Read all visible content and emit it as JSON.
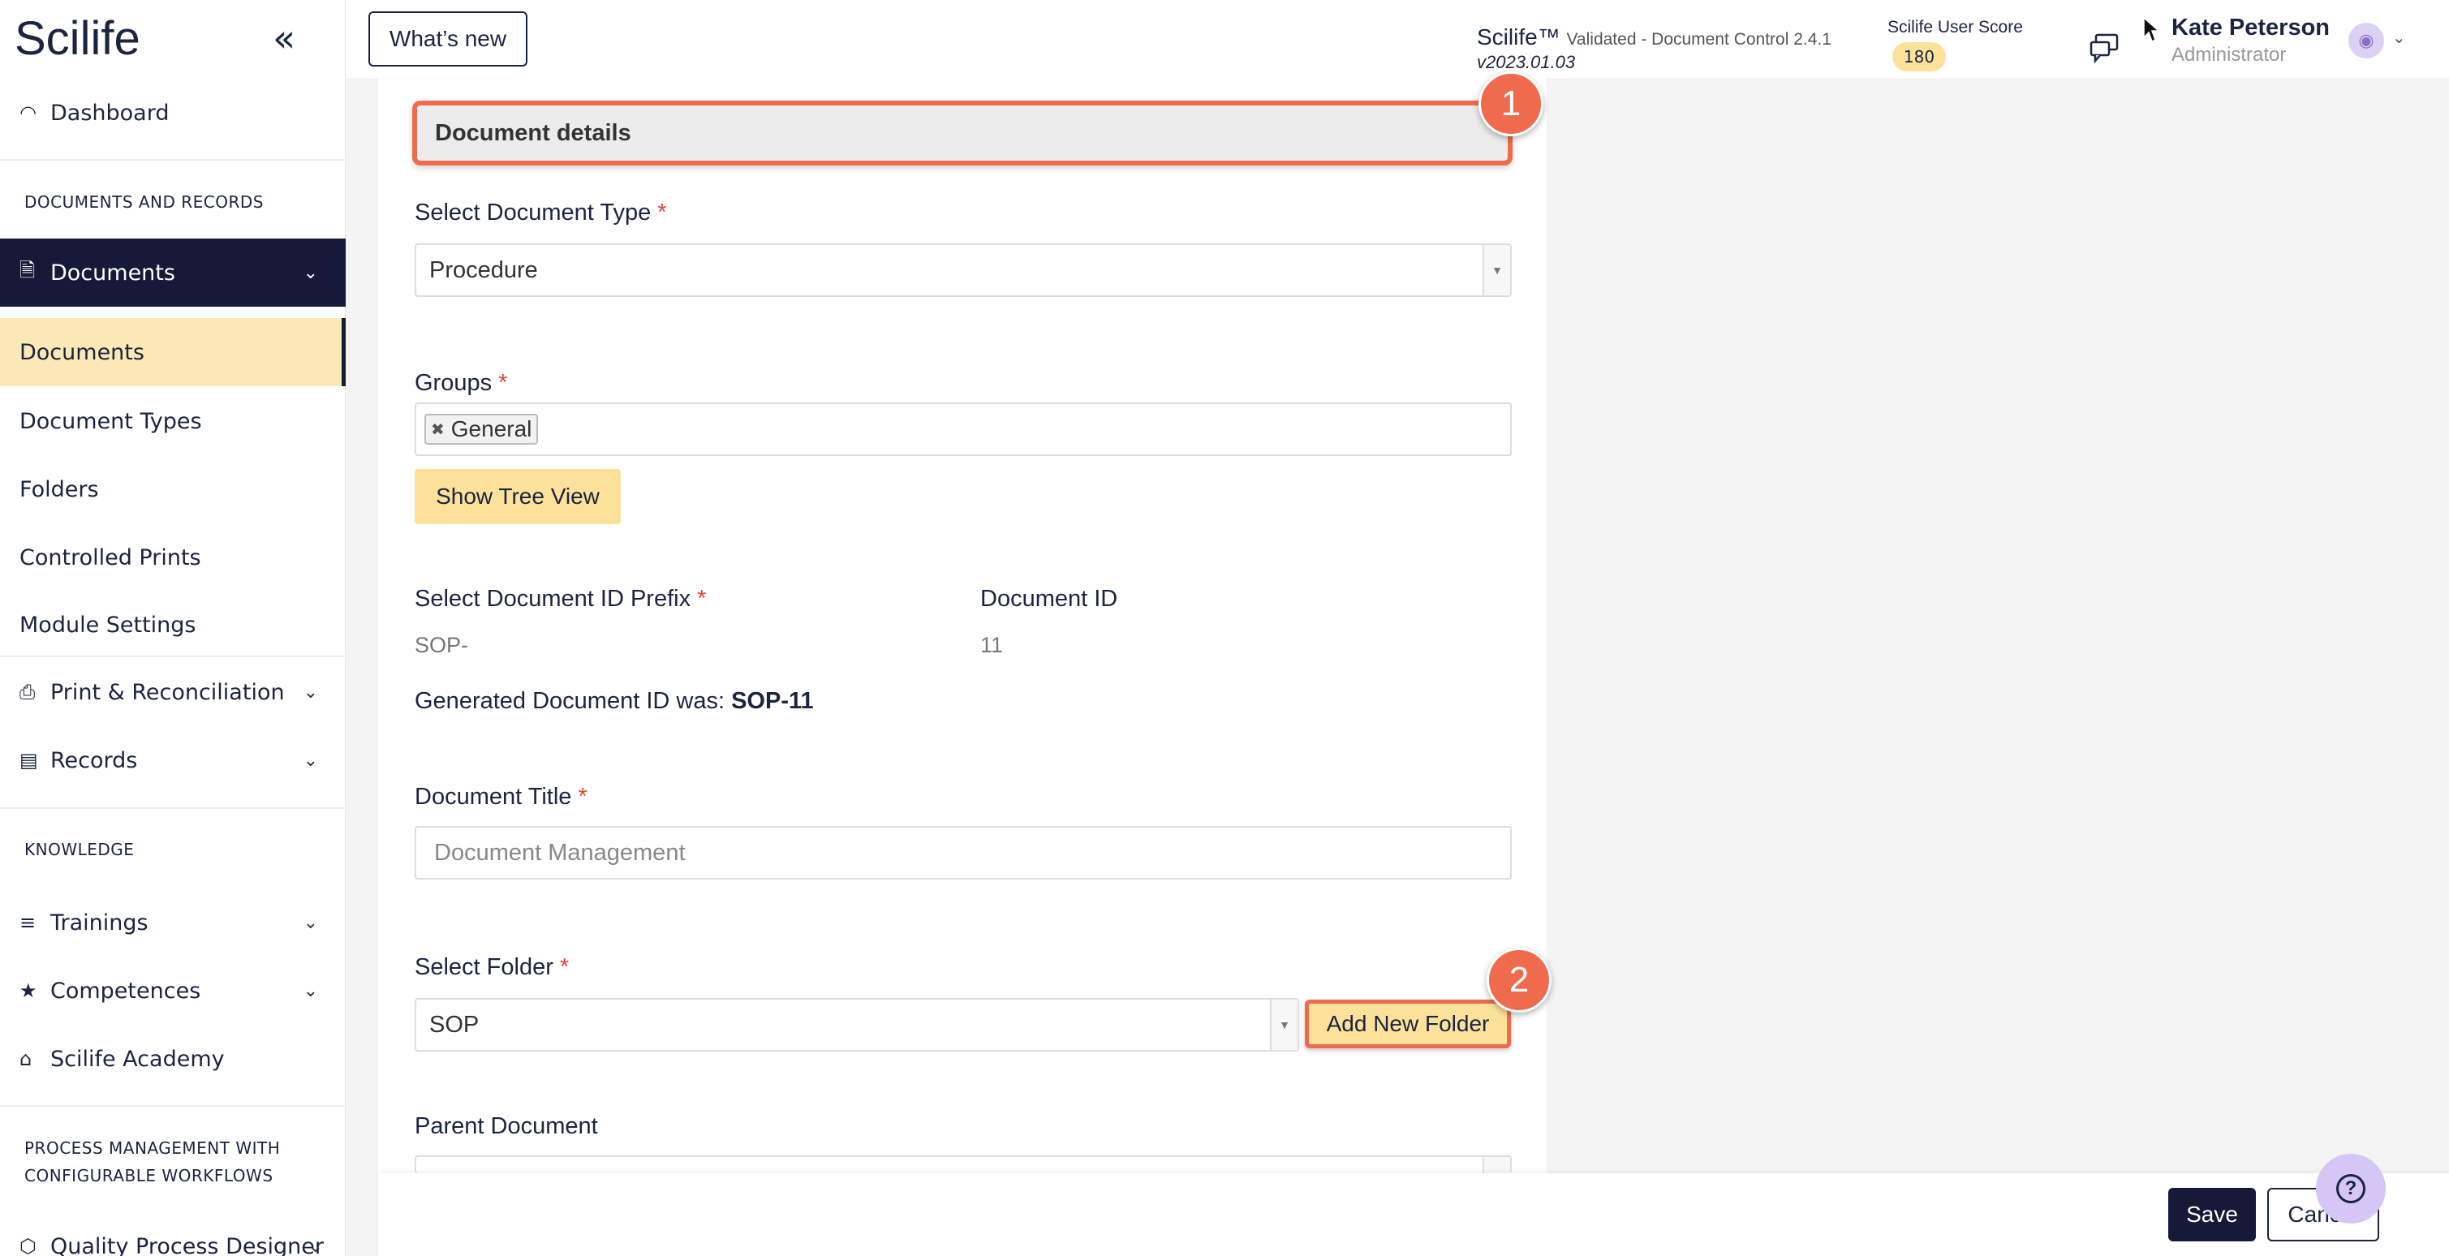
{
  "brand": {
    "logo": "Scilife",
    "collapse_icon": "double-chevron-left-icon"
  },
  "sidebar": {
    "dashboard": "Dashboard",
    "section_docs": "DOCUMENTS AND RECORDS",
    "documents_parent": "Documents",
    "sub_items": [
      "Documents",
      "Document Types",
      "Folders",
      "Controlled Prints",
      "Module Settings"
    ],
    "print_reconciliation": "Print & Reconciliation",
    "records": "Records",
    "section_knowledge": "KNOWLEDGE",
    "trainings": "Trainings",
    "competences": "Competences",
    "academy": "Scilife Academy",
    "section_process_1": "PROCESS MANAGEMENT WITH",
    "section_process_2": "CONFIGURABLE WORKFLOWS",
    "quality_process": "Quality Process Designer"
  },
  "topbar": {
    "whats_new": "What’s new",
    "app_name": "Scilife™",
    "app_validated": "Validated - Document Control 2.4.1",
    "app_version": "v2023.01.03",
    "score_label": "Scilife User Score",
    "score_value": "180",
    "user_name": "Kate Peterson",
    "user_role": "Administrator"
  },
  "form": {
    "section_title": "Document details",
    "step1": "1",
    "step2": "2",
    "doc_type_label": "Select Document Type",
    "doc_type_value": "Procedure",
    "groups_label": "Groups",
    "group_tag": "General",
    "tree_view_button": "Show Tree View",
    "prefix_label": "Select Document ID Prefix",
    "prefix_value": "SOP-",
    "doc_id_label": "Document ID",
    "doc_id_value": "11",
    "generated_prefix": "Generated Document ID was: ",
    "generated_value": "SOP-11",
    "title_label": "Document Title",
    "title_value": "Document Management",
    "folder_label": "Select Folder",
    "folder_value": "SOP",
    "add_folder_button": "Add New Folder",
    "parent_label": "Parent Document",
    "required_mark": "*"
  },
  "footer": {
    "save": "Save",
    "cancel": "Cancel",
    "help_icon": "question-icon"
  },
  "colors": {
    "navy": "#141a38",
    "yellow": "#fbe19a",
    "highlight": "#f06a4e",
    "active_bg": "#fbe9b5"
  }
}
